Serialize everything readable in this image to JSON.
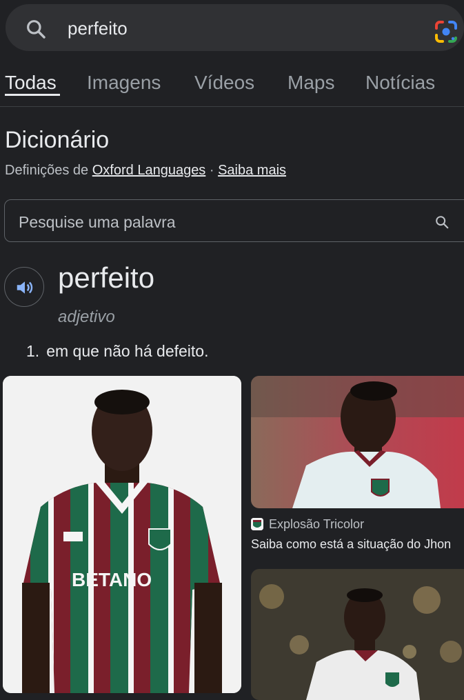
{
  "search": {
    "query": "perfeito"
  },
  "tabs": [
    {
      "label": "Todas",
      "active": true
    },
    {
      "label": "Imagens",
      "active": false
    },
    {
      "label": "Vídeos",
      "active": false
    },
    {
      "label": "Maps",
      "active": false
    },
    {
      "label": "Notícias",
      "active": false
    }
  ],
  "dictionary": {
    "title": "Dicionário",
    "source_prefix": "Definições de ",
    "source_link": "Oxford Languages",
    "separator": " · ",
    "learn_more": "Saiba mais",
    "word_search_placeholder": "Pesquise uma palavra",
    "headword": "perfeito",
    "part_of_speech": "adjetivo",
    "definitions": [
      {
        "number": "1.",
        "text": "em que não há defeito."
      }
    ]
  },
  "images": {
    "result_source": "Explosão Tricolor",
    "result_title": "Saiba como está a situação do Jhon",
    "shirt_sponsor": "BETANO"
  },
  "colors": {
    "background": "#202124",
    "searchbar": "#303134",
    "text_primary": "#e8eaed",
    "text_secondary": "#9aa0a6",
    "speaker_accent": "#8ab4f8",
    "jersey_maroon": "#7a1f2b",
    "jersey_green": "#1e6a4a"
  },
  "icons": {
    "search": "search-icon",
    "lens": "google-lens-icon",
    "speaker": "speaker-icon"
  }
}
